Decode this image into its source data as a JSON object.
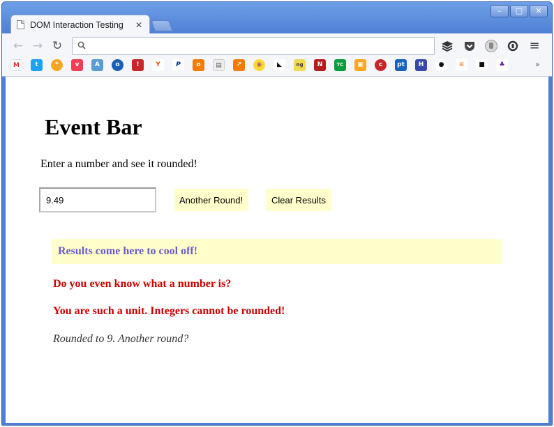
{
  "window": {
    "minimize": "–",
    "maximize": "□",
    "close": "✕"
  },
  "tab": {
    "title": "DOM Interaction Testing",
    "close": "✕"
  },
  "toolbar": {
    "back": "←",
    "forward": "→",
    "reload": "↻",
    "menu": "≡"
  },
  "bookmarks": {
    "more": "»"
  },
  "page": {
    "title": "Event Bar",
    "subtitle": "Enter a number and see it rounded!",
    "input_value": "9.49",
    "round_button": "Another Round!",
    "clear_button": "Clear Results",
    "results_heading": "Results come here to cool off!",
    "messages": [
      "Do you even know what a number is?",
      "You are such a unit. Integers cannot be rounded!"
    ],
    "rounded_text": "Rounded to 9. Another round?"
  },
  "colors": {
    "button_bg": "#ffffcc",
    "results_text": "#6a5acd",
    "error_text": "#cc0000"
  }
}
